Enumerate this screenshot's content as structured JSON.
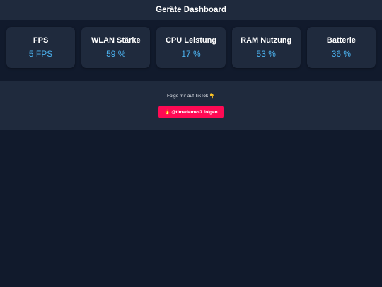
{
  "header": {
    "title": "Geräte Dashboard"
  },
  "cards": [
    {
      "label": "FPS",
      "value": "5 FPS"
    },
    {
      "label": "WLAN Stärke",
      "value": "59 %"
    },
    {
      "label": "CPU Leistung",
      "value": "17 %"
    },
    {
      "label": "RAM Nutzung",
      "value": "53 %"
    },
    {
      "label": "Batterie",
      "value": "36 %"
    }
  ],
  "follow": {
    "text": "Folge mir auf TikTok 👇",
    "button_label": "🔥 @timademes7 folgen"
  },
  "colors": {
    "background": "#111a2c",
    "panel": "#1f2a3d",
    "value_accent": "#4cb3f0",
    "button": "#ff0a54"
  }
}
